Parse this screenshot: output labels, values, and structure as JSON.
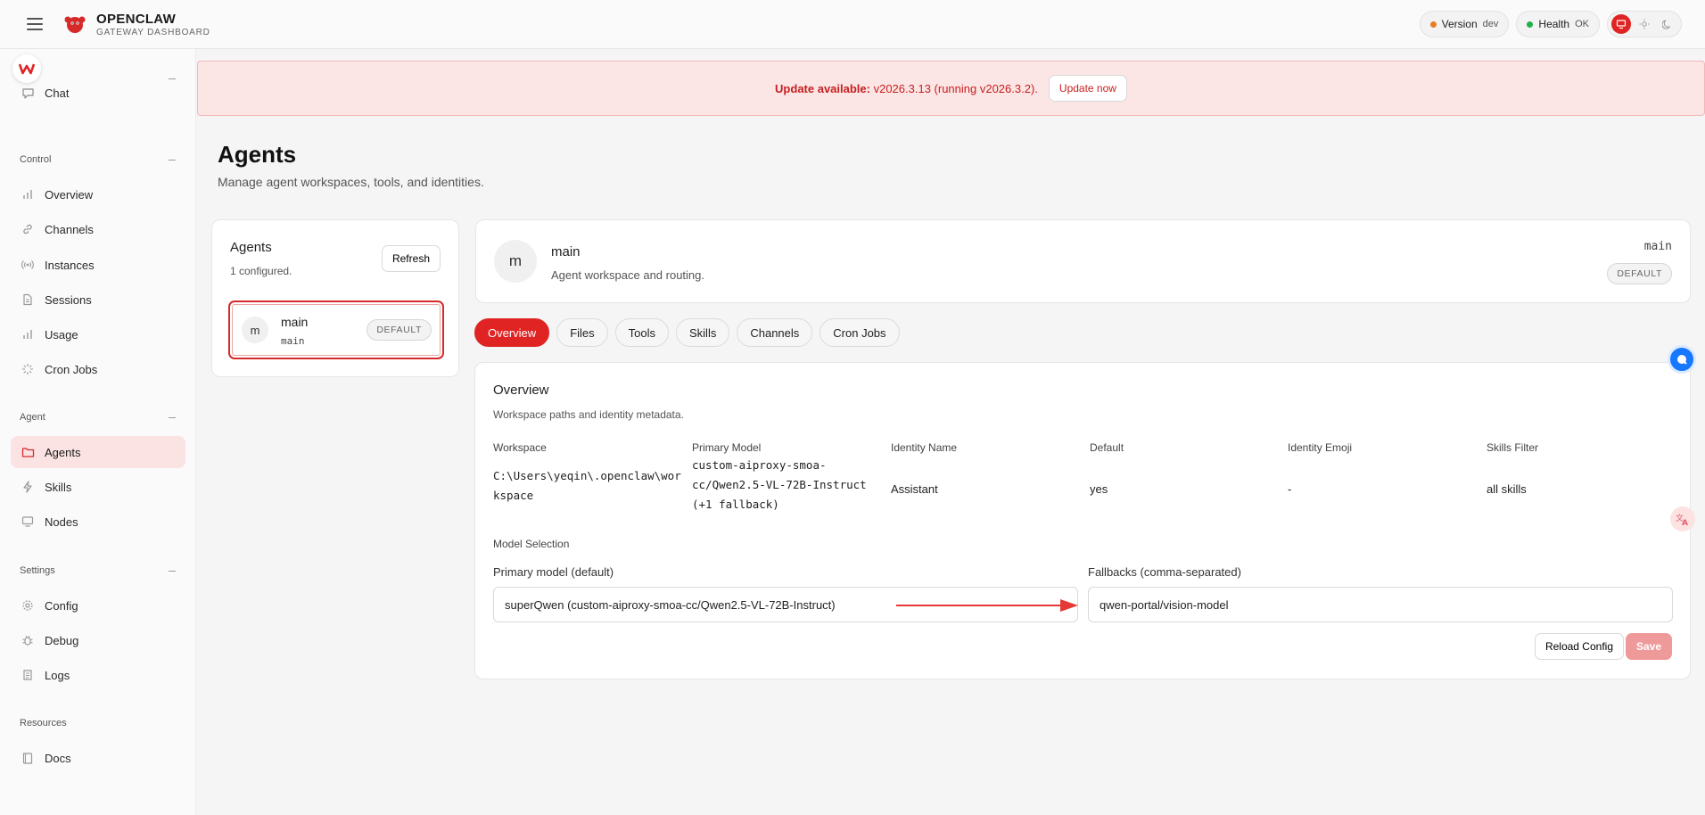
{
  "app": {
    "title": "OPENCLAW",
    "subtitle": "GATEWAY DASHBOARD",
    "version_label": "Version",
    "version_value": "dev",
    "health_label": "Health",
    "health_value": "OK",
    "colors": {
      "accent": "#e02424",
      "version_dot": "#e67e22",
      "health_dot": "#22b14c"
    }
  },
  "sidebar": {
    "chat": "Chat",
    "sections": {
      "control": "Control",
      "agent": "Agent",
      "settings": "Settings",
      "resources": "Resources"
    },
    "control_items": [
      {
        "label": "Overview",
        "icon": "bar-chart-icon"
      },
      {
        "label": "Channels",
        "icon": "link-icon"
      },
      {
        "label": "Instances",
        "icon": "radio-icon"
      },
      {
        "label": "Sessions",
        "icon": "file-icon"
      },
      {
        "label": "Usage",
        "icon": "bar-chart-icon"
      },
      {
        "label": "Cron Jobs",
        "icon": "loader-icon"
      }
    ],
    "agent_items": [
      {
        "label": "Agents",
        "icon": "folder-icon"
      },
      {
        "label": "Skills",
        "icon": "bolt-icon"
      },
      {
        "label": "Nodes",
        "icon": "monitor-icon"
      }
    ],
    "settings_items": [
      {
        "label": "Config",
        "icon": "gear-icon"
      },
      {
        "label": "Debug",
        "icon": "bug-icon"
      },
      {
        "label": "Logs",
        "icon": "scroll-icon"
      }
    ],
    "resources_items": [
      {
        "label": "Docs",
        "icon": "book-icon"
      }
    ]
  },
  "banner": {
    "prefix": "Update available:",
    "text": " v2026.3.13 (running v2026.3.2).",
    "button": "Update now"
  },
  "page": {
    "title": "Agents",
    "subtitle": "Manage agent workspaces, tools, and identities."
  },
  "agents_card": {
    "title": "Agents",
    "count": "1 configured.",
    "refresh": "Refresh",
    "items": [
      {
        "avatar": "m",
        "name": "main",
        "id": "main",
        "tag": "DEFAULT"
      }
    ]
  },
  "agent_header": {
    "avatar": "m",
    "name": "main",
    "description": "Agent workspace and routing.",
    "id": "main",
    "tag": "DEFAULT"
  },
  "tabs": [
    "Overview",
    "Files",
    "Tools",
    "Skills",
    "Channels",
    "Cron Jobs"
  ],
  "overview": {
    "title": "Overview",
    "subtitle": "Workspace paths and identity metadata.",
    "columns": [
      {
        "label": "Workspace",
        "value_lines": [
          "C:\\Users\\yeqin\\.openclaw\\wor",
          "kspace"
        ]
      },
      {
        "label": "Primary Model",
        "value_lines": [
          "custom-aiproxy-smoa-",
          "cc/Qwen2.5-VL-72B-Instruct",
          "(+1 fallback)"
        ]
      },
      {
        "label": "Identity Name",
        "value": "Assistant"
      },
      {
        "label": "Default",
        "value": "yes"
      },
      {
        "label": "Identity Emoji",
        "value": "-"
      },
      {
        "label": "Skills Filter",
        "value": "all skills"
      }
    ],
    "model_selection": "Model Selection",
    "primary_label": "Primary model (default)",
    "primary_value": "superQwen (custom-aiproxy-smoa-cc/Qwen2.5-VL-72B-Instruct)",
    "fallbacks_label": "Fallbacks (comma-separated)",
    "fallbacks_value": "qwen-portal/vision-model",
    "reload": "Reload Config",
    "save": "Save"
  }
}
